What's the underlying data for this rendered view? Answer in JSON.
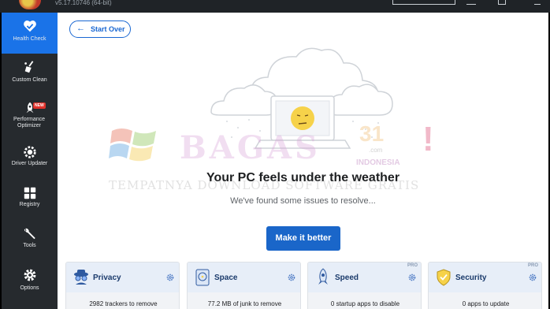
{
  "app": {
    "version": "v5.17.10746 (64-bit)"
  },
  "sidebar": {
    "items": [
      {
        "label": "Health Check",
        "icon": "heart-check-icon",
        "active": true
      },
      {
        "label": "Custom Clean",
        "icon": "broom-icon"
      },
      {
        "label": "Performance Optimizer",
        "icon": "rocket-icon",
        "badge": "NEW"
      },
      {
        "label": "Driver Updater",
        "icon": "gear-chip-icon"
      },
      {
        "label": "Registry",
        "icon": "grid-icon"
      },
      {
        "label": "Tools",
        "icon": "wrench-icon"
      },
      {
        "label": "Options",
        "icon": "gear-icon"
      }
    ]
  },
  "main": {
    "start_over": "Start Over",
    "headline": "Your PC feels under the weather",
    "subline": "We've found some issues to resolve...",
    "cta": "Make it better",
    "cards": [
      {
        "title": "Privacy",
        "value": "2982 trackers to remove",
        "icon": "spy-icon",
        "pro": ""
      },
      {
        "title": "Space",
        "value": "77.2 MB of junk to remove",
        "icon": "disk-icon",
        "pro": ""
      },
      {
        "title": "Speed",
        "value": "0 startup apps to disable",
        "icon": "rocket-icon",
        "pro": "PRO"
      },
      {
        "title": "Security",
        "value": "0 apps to update",
        "icon": "shield-icon",
        "pro": "PRO"
      }
    ]
  },
  "watermark": {
    "brand": "BAGAS",
    "number": "31",
    "domain": ".com",
    "country": "INDONESIA",
    "tagline": "TEMPATNYA DOWNLOAD SOFTWARE GRATIS",
    "mark": "!"
  },
  "colors": {
    "accent": "#1a73e8",
    "sidebar": "#262a2e",
    "cta": "#1a66c9"
  }
}
